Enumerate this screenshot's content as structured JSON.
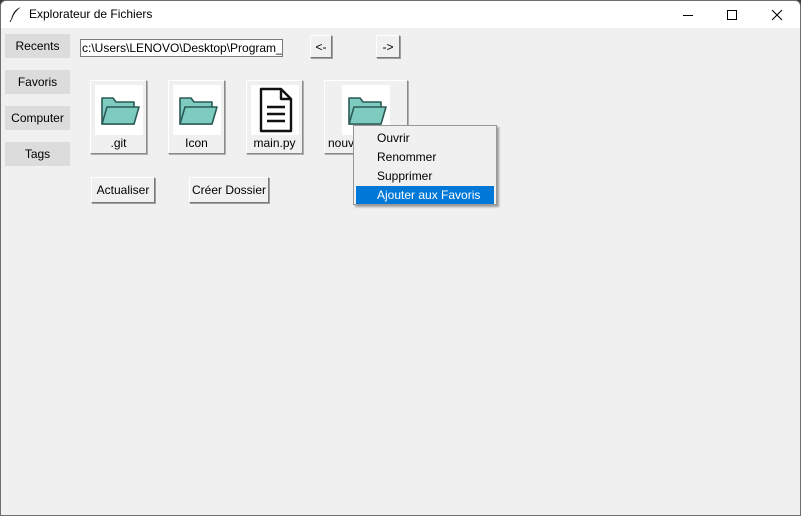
{
  "window": {
    "title": "Explorateur de Fichiers",
    "icon": "feather-icon",
    "controls": [
      "minimize-icon",
      "maximize-icon",
      "close-icon"
    ]
  },
  "sidebar": {
    "items": [
      {
        "label": "Recents"
      },
      {
        "label": "Favoris"
      },
      {
        "label": "Computer"
      },
      {
        "label": "Tags"
      }
    ]
  },
  "toolbar": {
    "path_value": "c:\\Users\\LENOVO\\Desktop\\Program_d",
    "back_label": "<-",
    "forward_label": "->"
  },
  "files": [
    {
      "name": ".git",
      "icon": "folder-icon"
    },
    {
      "name": "Icon",
      "icon": "folder-icon"
    },
    {
      "name": "main.py",
      "icon": "document-icon"
    },
    {
      "name": "nouv",
      "icon": "folder-icon"
    }
  ],
  "actions": {
    "refresh_label": "Actualiser",
    "create_folder_label": "Créer Dossier"
  },
  "context_menu": {
    "items": [
      {
        "label": "Ouvrir"
      },
      {
        "label": "Renommer"
      },
      {
        "label": "Supprimer"
      },
      {
        "label": "Ajouter aux Favoris",
        "highlighted": true
      }
    ]
  },
  "colors": {
    "folder_fill": "#7ecbc0",
    "folder_stroke": "#2a5a55",
    "highlight": "#0078d7",
    "background": "#f0f0f0"
  }
}
